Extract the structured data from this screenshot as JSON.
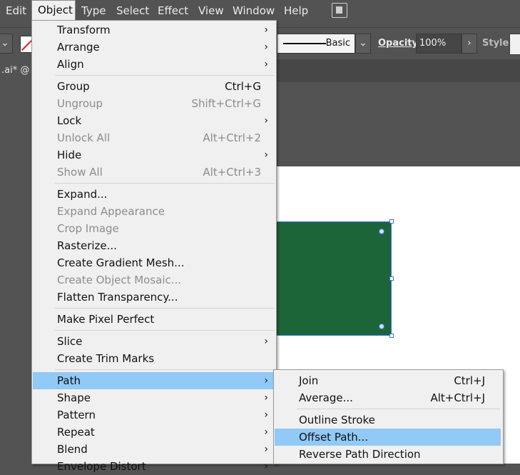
{
  "menubar": {
    "items": [
      "Edit",
      "Object",
      "Type",
      "Select",
      "Effect",
      "View",
      "Window",
      "Help"
    ],
    "active": "Object"
  },
  "controlbar": {
    "stroke_style": "Basic",
    "opacity_label": "Opacity:",
    "opacity_value": "100%",
    "style_label": "Style:"
  },
  "document_tab": ".ai* @",
  "object_menu": {
    "groups": [
      [
        {
          "label": "Transform",
          "submenu": true
        },
        {
          "label": "Arrange",
          "submenu": true
        },
        {
          "label": "Align",
          "submenu": true
        }
      ],
      [
        {
          "label": "Group",
          "shortcut": "Ctrl+G"
        },
        {
          "label": "Ungroup",
          "shortcut": "Shift+Ctrl+G",
          "disabled": true
        },
        {
          "label": "Lock",
          "submenu": true
        },
        {
          "label": "Unlock All",
          "shortcut": "Alt+Ctrl+2",
          "disabled": true
        },
        {
          "label": "Hide",
          "submenu": true
        },
        {
          "label": "Show All",
          "shortcut": "Alt+Ctrl+3",
          "disabled": true
        }
      ],
      [
        {
          "label": "Expand..."
        },
        {
          "label": "Expand Appearance",
          "disabled": true
        },
        {
          "label": "Crop Image",
          "disabled": true
        },
        {
          "label": "Rasterize..."
        },
        {
          "label": "Create Gradient Mesh..."
        },
        {
          "label": "Create Object Mosaic...",
          "disabled": true
        },
        {
          "label": "Flatten Transparency..."
        }
      ],
      [
        {
          "label": "Make Pixel Perfect"
        }
      ],
      [
        {
          "label": "Slice",
          "submenu": true
        },
        {
          "label": "Create Trim Marks"
        }
      ],
      [
        {
          "label": "Path",
          "submenu": true,
          "highlighted": true
        },
        {
          "label": "Shape",
          "submenu": true
        },
        {
          "label": "Pattern",
          "submenu": true
        },
        {
          "label": "Repeat",
          "submenu": true
        },
        {
          "label": "Blend",
          "submenu": true
        },
        {
          "label": "Envelope Distort",
          "submenu": true
        }
      ]
    ]
  },
  "path_submenu": {
    "groups": [
      [
        {
          "label": "Join",
          "shortcut": "Ctrl+J"
        },
        {
          "label": "Average...",
          "shortcut": "Alt+Ctrl+J"
        }
      ],
      [
        {
          "label": "Outline Stroke"
        },
        {
          "label": "Offset Path...",
          "highlighted": true
        },
        {
          "label": "Reverse Path Direction"
        }
      ]
    ]
  },
  "colors": {
    "rect_fill": "#1b6538",
    "selection": "#3d73d8",
    "highlight": "#91c9f7"
  },
  "icons": {
    "submenu_arrow": "chevron-right-icon"
  }
}
